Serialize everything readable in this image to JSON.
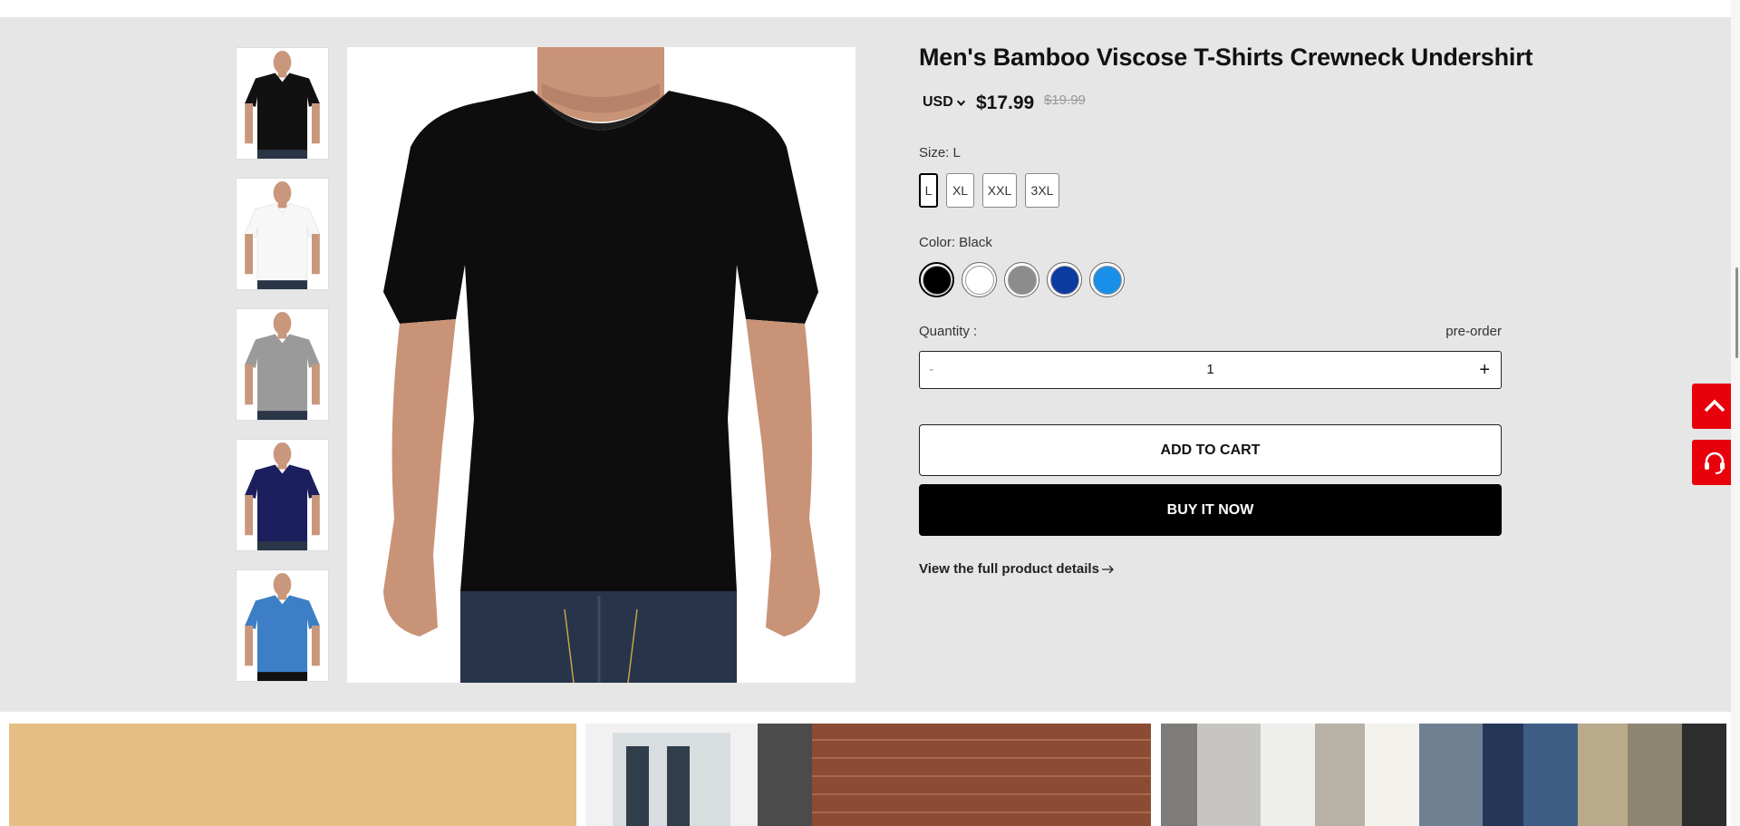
{
  "product": {
    "title": "Men's Bamboo Viscose T-Shirts Crewneck Undershirt",
    "currency": "USD",
    "price": "$17.99",
    "compare_price": "$19.99",
    "size_label": "Size: L",
    "sizes": [
      "L",
      "XL",
      "XXL",
      "3XL"
    ],
    "selected_size": "L",
    "color_label": "Color: Black",
    "colors": [
      {
        "name": "Black",
        "hex": "#000000"
      },
      {
        "name": "White",
        "hex": "#ffffff"
      },
      {
        "name": "Gray",
        "hex": "#8c8c8c"
      },
      {
        "name": "Navy",
        "hex": "#0b3aa0"
      },
      {
        "name": "Blue",
        "hex": "#1a8fe8"
      }
    ],
    "selected_color": "Black",
    "thumbnail_colors": [
      "#111111",
      "#f7f7f7",
      "#9a9a9a",
      "#1c1f5e",
      "#3c7fc6"
    ],
    "quantity_label": "Quantity :",
    "stock_status": "pre-order",
    "quantity_minus": "-",
    "quantity": "1",
    "quantity_plus": "+",
    "add_to_cart": "ADD TO CART",
    "buy_now": "BUY IT NOW",
    "details_link": "View the full product details"
  },
  "floating": {
    "back_to_top_icon": "chevron-up-icon",
    "support_icon": "headset-icon",
    "accent": "#e8000b"
  }
}
